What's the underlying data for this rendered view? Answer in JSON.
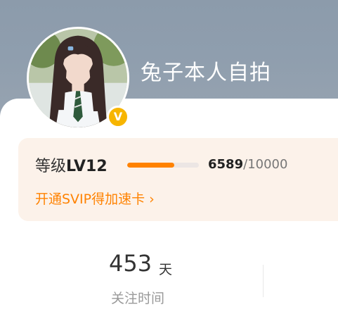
{
  "profile": {
    "username": "兔子本人自拍",
    "badge": "V"
  },
  "level": {
    "prefix": "等级",
    "value": "LV12",
    "progress_current": "6589",
    "progress_separator": "/",
    "progress_max": "10000",
    "progress_fraction": 0.6589,
    "svip_link": "开通SVIP得加速卡",
    "svip_chevron": "›"
  },
  "stats": {
    "follow_days_value": "453",
    "follow_days_unit": "天",
    "follow_days_label": "关注时间"
  },
  "colors": {
    "accent": "#ff8200",
    "badge": "#f7b500",
    "level_card_bg": "#fcf2ea"
  },
  "icons": {
    "verified": "verified-v-badge",
    "link_arrow": "chevron-right-icon"
  }
}
